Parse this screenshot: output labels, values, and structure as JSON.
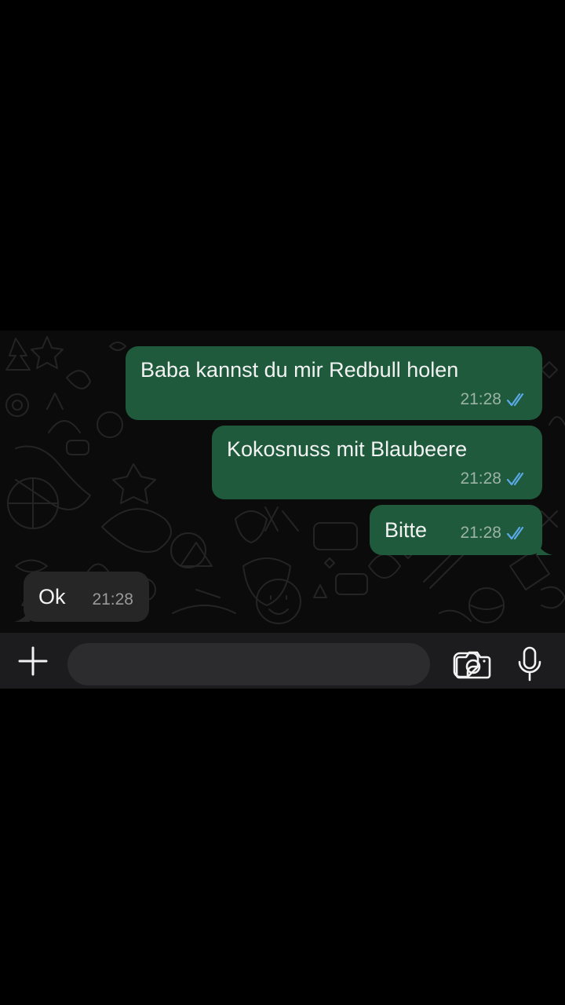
{
  "messages": [
    {
      "direction": "outgoing",
      "text": "Baba kannst du mir Redbull holen",
      "time": "21:28",
      "status": "read"
    },
    {
      "direction": "outgoing",
      "text": "Kokosnuss mit Blaubeere",
      "time": "21:28",
      "status": "read"
    },
    {
      "direction": "outgoing",
      "text": "Bitte",
      "time": "21:28",
      "status": "read"
    },
    {
      "direction": "incoming",
      "text": "Ok",
      "time": "21:28"
    }
  ],
  "composer": {
    "value": "",
    "placeholder": "",
    "icons": {
      "attach": "plus-icon",
      "sticker": "sticker-icon",
      "camera": "camera-icon",
      "voice": "microphone-icon"
    }
  },
  "colors": {
    "background": "#000000",
    "chat_background": "#0b0b0b",
    "outgoing_bubble": "#1f5a3c",
    "incoming_bubble": "#262626",
    "read_ticks": "#5aa9e6",
    "input_bar": "#1c1c1e",
    "input_field": "#2c2c2e"
  }
}
